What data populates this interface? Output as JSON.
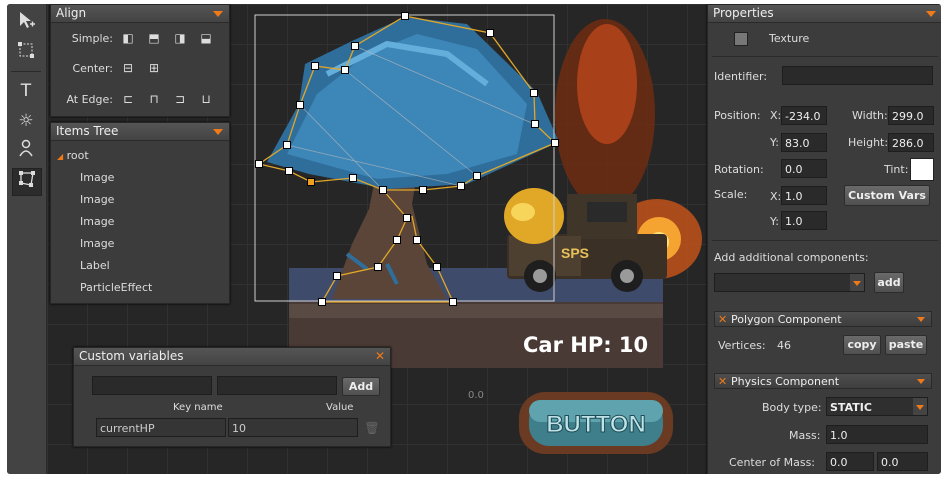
{
  "align": {
    "title": "Align",
    "simple_label": "Simple:",
    "center_label": "Center:",
    "edge_label": "At Edge:"
  },
  "items_tree": {
    "title": "Items Tree",
    "root": "root",
    "items": [
      "Image",
      "Image",
      "Image",
      "Image",
      "Label",
      "ParticleEffect"
    ]
  },
  "custom_variables": {
    "title": "Custom variables",
    "add_label": "Add",
    "key_header": "Key name",
    "value_header": "Value",
    "rows": [
      {
        "key": "currentHP",
        "value": "10"
      }
    ]
  },
  "canvas": {
    "hp_text": "Car HP: 10",
    "button_text": "BUTTON",
    "truck_text": "SPS",
    "coord_readout": "0.0"
  },
  "properties": {
    "title": "Properties",
    "texture_label": "Texture",
    "identifier_label": "Identifier:",
    "identifier_value": "",
    "position_label": "Position:",
    "x_label": "X:",
    "y_label": "Y:",
    "position_x": "-234.0",
    "position_y": "83.0",
    "width_label": "Width:",
    "width_value": "299.0",
    "height_label": "Height:",
    "height_value": "286.0",
    "rotation_label": "Rotation:",
    "rotation_value": "0.0",
    "tint_label": "Tint:",
    "tint_color": "#ffffff",
    "scale_label": "Scale:",
    "scale_x": "1.0",
    "scale_y": "1.0",
    "custom_vars_label": "Custom Vars",
    "add_components_label": "Add additional components:",
    "add_button": "add",
    "polygon": {
      "title": "Polygon Component",
      "vertices_label": "Vertices:",
      "vertices_value": "46",
      "copy_label": "copy",
      "paste_label": "paste"
    },
    "physics": {
      "title": "Physics Component",
      "body_type_label": "Body type:",
      "body_type_value": "STATIC",
      "mass_label": "Mass:",
      "mass_value": "1.0",
      "center_mass_label": "Center of Mass:",
      "center_x": "0.0",
      "center_y": "0.0"
    }
  },
  "colors": {
    "accent": "#f07a18"
  }
}
